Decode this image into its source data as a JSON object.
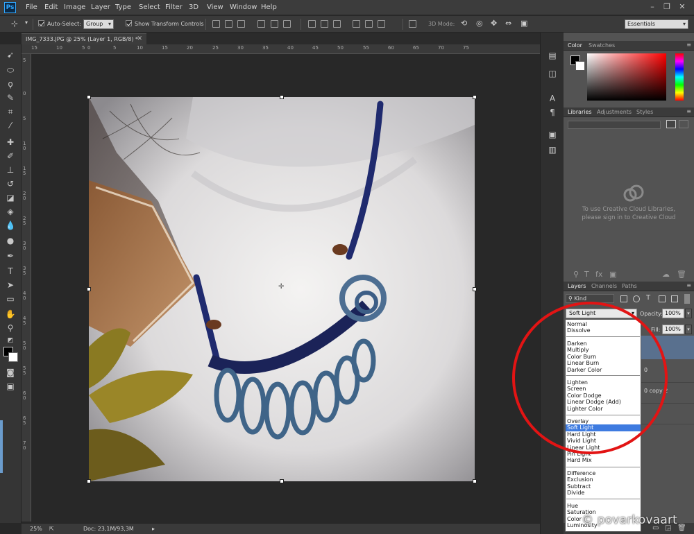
{
  "app": {
    "logo": "Ps"
  },
  "menu": [
    "File",
    "Edit",
    "Image",
    "Layer",
    "Type",
    "Select",
    "Filter",
    "3D",
    "View",
    "Window",
    "Help"
  ],
  "options_bar": {
    "auto_select_label": "Auto-Select:",
    "auto_select_value": "Group",
    "transform_label": "Show Transform Controls",
    "mode_label": "3D Mode:",
    "workspace": "Essentials"
  },
  "document_tab": {
    "title": "IMG_7333.JPG @ 25% (Layer 1, RGB/8) *"
  },
  "ruler": {
    "top_ticks": [
      "15",
      "10",
      "5",
      "0",
      "5",
      "10",
      "15",
      "20",
      "25",
      "30",
      "35",
      "40",
      "45",
      "50",
      "55",
      "60",
      "65",
      "70",
      "75"
    ],
    "left_ticks": [
      "5",
      "0",
      "5",
      "10",
      "15",
      "20",
      "25",
      "30",
      "35",
      "40",
      "45",
      "50",
      "55",
      "60",
      "65",
      "70"
    ]
  },
  "status": {
    "zoom": "25%",
    "doc": "Doc: 23,1M/93,3M"
  },
  "color_panel": {
    "tabs": [
      "Color",
      "Swatches"
    ]
  },
  "libraries_panel": {
    "tabs": [
      "Libraries",
      "Adjustments",
      "Styles"
    ],
    "message_line1": "To use Creative Cloud Libraries,",
    "message_line2": "please sign in to Creative Cloud"
  },
  "layers_panel": {
    "tabs": [
      "Layers",
      "Channels",
      "Paths"
    ],
    "filter_label": "Kind",
    "blend_mode": "Soft Light",
    "opacity_label": "Opacity:",
    "opacity_value": "100%",
    "fill_label": "Fill:",
    "fill_value": "100%",
    "layer_fragment_1": "0",
    "layer_fragment_2": "0 copy 2"
  },
  "blend_dropdown": {
    "groups": [
      [
        "Normal",
        "Dissolve"
      ],
      [
        "Darken",
        "Multiply",
        "Color Burn",
        "Linear Burn",
        "Darker Color"
      ],
      [
        "Lighten",
        "Screen",
        "Color Dodge",
        "Linear Dodge (Add)",
        "Lighter Color"
      ],
      [
        "Overlay",
        "Soft Light",
        "Hard Light",
        "Vivid Light",
        "Linear Light",
        "Pin Light",
        "Hard Mix"
      ],
      [
        "Difference",
        "Exclusion",
        "Subtract",
        "Divide"
      ],
      [
        "Hue",
        "Saturation",
        "Color",
        "Luminosity"
      ]
    ],
    "selected": "Soft Light"
  },
  "watermark": "© povarkovaart",
  "colors": {
    "highlight": "#3e7be0",
    "annotation": "#e21414",
    "accent": "#31a8ff"
  },
  "icons": [
    "move-tool-icon",
    "marquee-tool-icon",
    "lasso-tool-icon",
    "quick-select-tool-icon",
    "crop-tool-icon",
    "eyedropper-tool-icon",
    "healing-brush-icon",
    "brush-tool-icon",
    "clone-stamp-icon",
    "history-brush-icon",
    "eraser-tool-icon",
    "paint-bucket-icon",
    "blur-tool-icon",
    "dodge-tool-icon",
    "pen-tool-icon",
    "type-tool-icon",
    "path-select-icon",
    "rectangle-tool-icon",
    "hand-tool-icon",
    "zoom-tool-icon"
  ]
}
